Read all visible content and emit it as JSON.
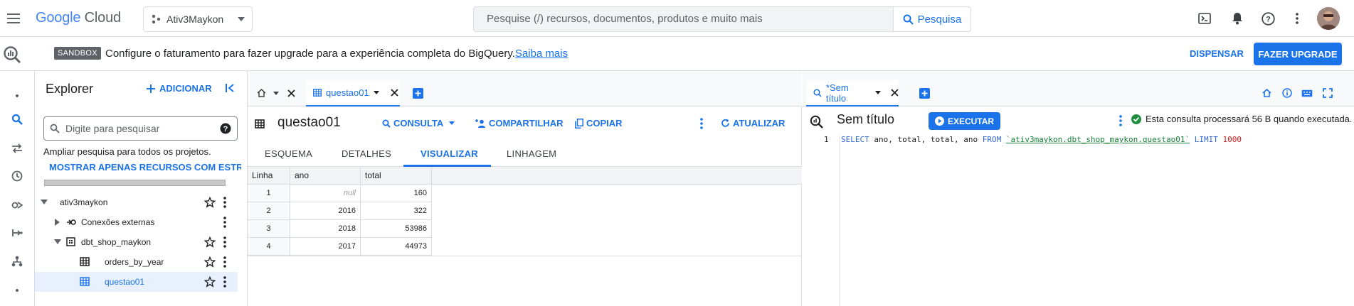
{
  "topbar": {
    "logo_google": "Google",
    "logo_cloud": "Cloud",
    "project": "Ativ3Maykon",
    "search_placeholder": "Pesquise (/) recursos, documentos, produtos e muito mais",
    "search_button": "Pesquisa"
  },
  "banner": {
    "badge": "SANDBOX",
    "text": "Configure o faturamento para fazer upgrade para a experiência completa do BigQuery.",
    "link": "Saiba mais",
    "dismiss": "DISPENSAR",
    "upgrade": "FAZER UPGRADE"
  },
  "explorer": {
    "title": "Explorer",
    "add": "ADICIONAR",
    "search_placeholder": "Digite para pesquisar",
    "hint": "Ampliar pesquisa para todos os projetos.",
    "show_only": "MOSTRAR APENAS RECURSOS COM ESTRELA",
    "tree": {
      "project": "ativ3maykon",
      "external": "Conexões externas",
      "dataset": "dbt_shop_maykon",
      "table1": "orders_by_year",
      "table2": "questao01"
    }
  },
  "center": {
    "tab_label": "questao01",
    "title": "questao01",
    "toolbar": {
      "query": "CONSULTA",
      "share": "COMPARTILHAR",
      "copy": "COPIAR",
      "refresh": "ATUALIZAR"
    },
    "subtabs": [
      "ESQUEMA",
      "DETALHES",
      "VISUALIZAR",
      "LINHAGEM"
    ],
    "active_subtab": "VISUALIZAR",
    "table": {
      "headers": [
        "Linha",
        "ano",
        "total"
      ],
      "rows": [
        {
          "linha": "1",
          "ano": "null",
          "total": "160"
        },
        {
          "linha": "2",
          "ano": "2016",
          "total": "322"
        },
        {
          "linha": "3",
          "ano": "2018",
          "total": "53986"
        },
        {
          "linha": "4",
          "ano": "2017",
          "total": "44973"
        }
      ]
    }
  },
  "editor": {
    "tab_label": "*Sem título",
    "title": "Sem título",
    "run": "EXECUTAR",
    "status": "Esta consulta processará 56 B quando executada.",
    "line_number": "1",
    "code": {
      "select": "SELECT",
      "fields": " ano, total, total, ano ",
      "from": "FROM",
      "table": "`ativ3maykon.dbt_shop_maykon.questao01`",
      "limit": "LIMIT",
      "limit_value": "1000"
    }
  },
  "colors": {
    "accent": "#1a73e8",
    "success": "#1e8e3e"
  }
}
